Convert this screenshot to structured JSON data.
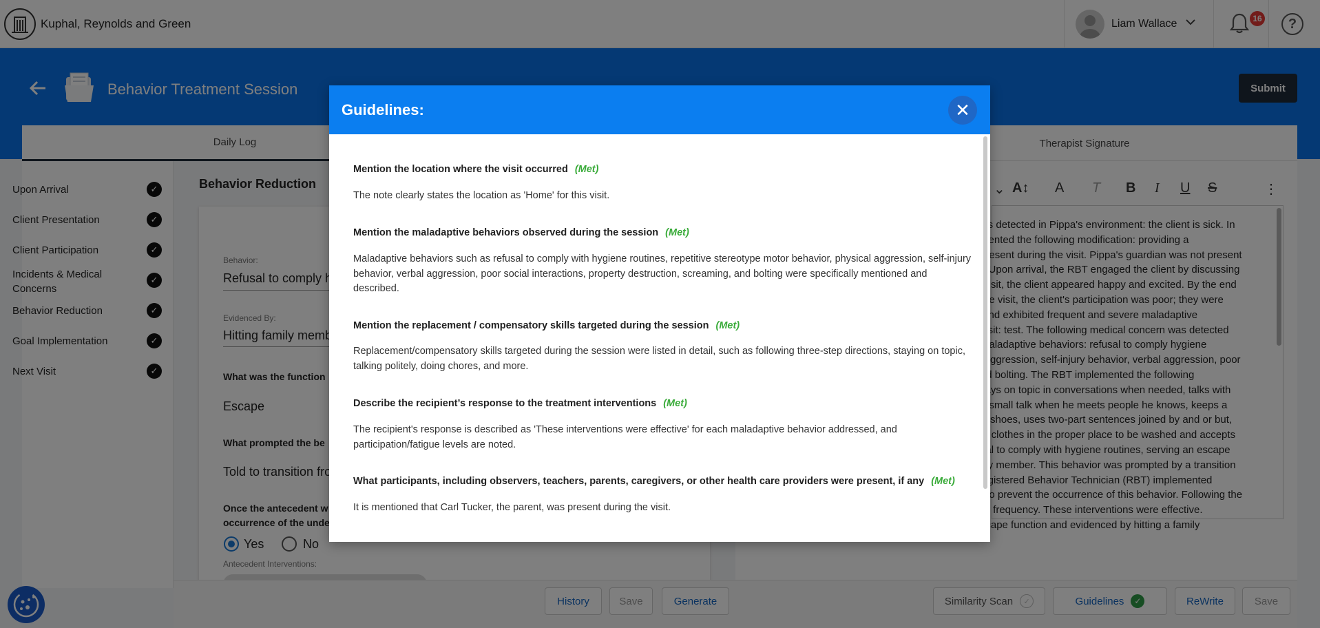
{
  "header": {
    "org_name": "Kuphal, Reynolds and Green",
    "user_name": "Liam Wallace",
    "notification_count": "16",
    "help_glyph": "?"
  },
  "page": {
    "title": "Behavior Treatment Session",
    "submit_label": "Submit"
  },
  "tabs": [
    {
      "label": "Daily Log"
    },
    {
      "label": "Therapist Signature"
    }
  ],
  "sidebar": {
    "items": [
      {
        "label": "Upon Arrival"
      },
      {
        "label": "Client Presentation"
      },
      {
        "label": "Client Participation"
      },
      {
        "label": "Incidents & Medical\nConcerns"
      },
      {
        "label": "Behavior Reduction"
      },
      {
        "label": "Goal Implementation"
      },
      {
        "label": "Next Visit"
      }
    ]
  },
  "form": {
    "section_title": "Behavior Reduction",
    "behavior_label": "Behavior:",
    "behavior_value": "Refusal to comply h",
    "evidenced_label": "Evidenced By:",
    "evidenced_value": "Hitting family memb",
    "function_question": "What was the function",
    "function_value": "Escape",
    "prompted_question": "What prompted the be",
    "prompted_value": "Told to transition fro",
    "antecedent_question": "Once the antecedent w\noccurrence of the unde",
    "radio_yes": "Yes",
    "radio_no": "No",
    "antecedent_label": "Antecedent Interventions:"
  },
  "editor": {
    "text": "e was detected in Pippa's environment: the client is sick. In\nplemented the following modification: providing a\nas present during the visit. Pippa's guardian was not present\nting. Upon arrival, the RBT engaged the client by discussing\nthe visit, the client appeared happy and excited. By the end\nng the visit, the client's participation was poor; they were\npts and exhibited frequent and severe maladaptive\nhe visit: test. The following medical concern was detected\nng maladaptive behaviors: refusal to comply hygiene\nical aggression, self-injury behavior, verbal aggression, poor\ng and bolting. The RBT implemented the following\ns, stays on topic in conversations when needed, talks with\ntarts small talk when he meets people he knows, keeps a\ns his shoes, uses two-part sentences joined by and or but,\nserts clothes in the proper place to be washed and accepts\nefusal to comply with hygiene routines, serving an escape\nfamily member. This behavior was prompted by a transition\ne Registered Behavior Technician (RBT) implemented\nmpt to prevent the occurrence of this behavior. Following the\nce its frequency. These interventions were effective.\nn escape function and evidenced by hitting a family"
  },
  "footer": {
    "history": "History",
    "save_left": "Save",
    "generate": "Generate",
    "similarity_scan": "Similarity Scan",
    "guidelines": "Guidelines",
    "rewrite": "ReWrite",
    "save_right": "Save"
  },
  "modal": {
    "title": "Guidelines:",
    "close_glyph": "✕",
    "items": [
      {
        "title": "Mention the location where the visit occurred",
        "status": "(Met)",
        "desc": "The note clearly states the location as 'Home' for this visit."
      },
      {
        "title": "Mention the maladaptive behaviors observed during the session",
        "status": "(Met)",
        "desc": "Maladaptive behaviors such as refusal to comply with hygiene routines, repetitive stereotype motor behavior, physical aggression, self-injury behavior, verbal aggression, poor social interactions, property destruction, screaming, and bolting were specifically mentioned and described."
      },
      {
        "title": "Mention the replacement / compensatory skills targeted during the session",
        "status": "(Met)",
        "desc": "Replacement/compensatory skills targeted during the session were listed in detail, such as following three-step directions, staying on topic, talking politely, doing chores, and more."
      },
      {
        "title": "Describe the recipient’s response to the treatment interventions",
        "status": "(Met)",
        "desc": "The recipient's response is described as 'These interventions were effective' for each maladaptive behavior addressed, and participation/fatigue levels are noted."
      },
      {
        "title": "What participants, including observers, teachers, parents, caregivers, or other health care providers were present, if any",
        "status": "(Met)",
        "desc": "It is mentioned that Carl Tucker, the parent, was present during the visit."
      }
    ]
  },
  "colors": {
    "brand_blue": "#0b73e8",
    "modal_header": "#0b7ef0",
    "met_green": "#3aab3a",
    "badge_red": "#e53935"
  },
  "icons": [
    "building-logo-icon",
    "chevron-down-icon",
    "bell-icon",
    "help-icon",
    "back-arrow-icon",
    "folder-icon",
    "check-circle-icon",
    "close-icon",
    "cookie-icon"
  ]
}
